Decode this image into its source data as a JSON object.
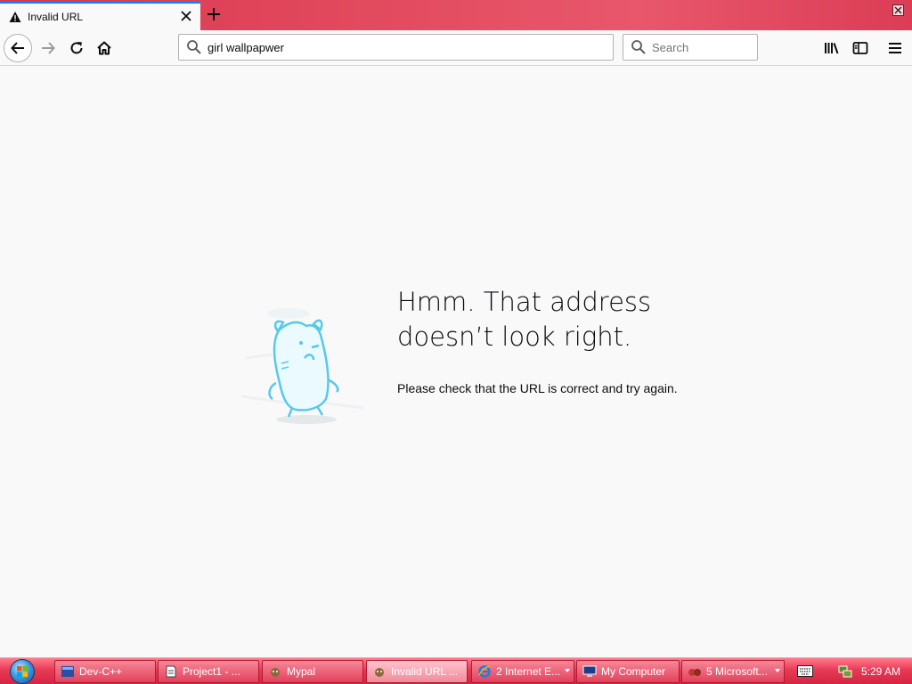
{
  "tab": {
    "title": "Invalid URL"
  },
  "urlbar": {
    "value": "girl wallpapwer"
  },
  "searchbar": {
    "placeholder": "Search"
  },
  "error": {
    "title": "Hmm. That address doesn’t look right.",
    "description": "Please check that the URL is correct and try again."
  },
  "taskbar": {
    "items": [
      {
        "label": "Dev-C++"
      },
      {
        "label": "Project1 - ..."
      },
      {
        "label": "Mypal"
      },
      {
        "label": "Invalid URL ..."
      },
      {
        "label": "2 Internet E..."
      },
      {
        "label": "My Computer"
      },
      {
        "label": "5 Microsoft..."
      }
    ],
    "clock": "5:29 AM"
  },
  "colors": {
    "accent": "#0a84ff",
    "taskbar": "#e83a55",
    "tabstrip": "#e24a5e"
  }
}
